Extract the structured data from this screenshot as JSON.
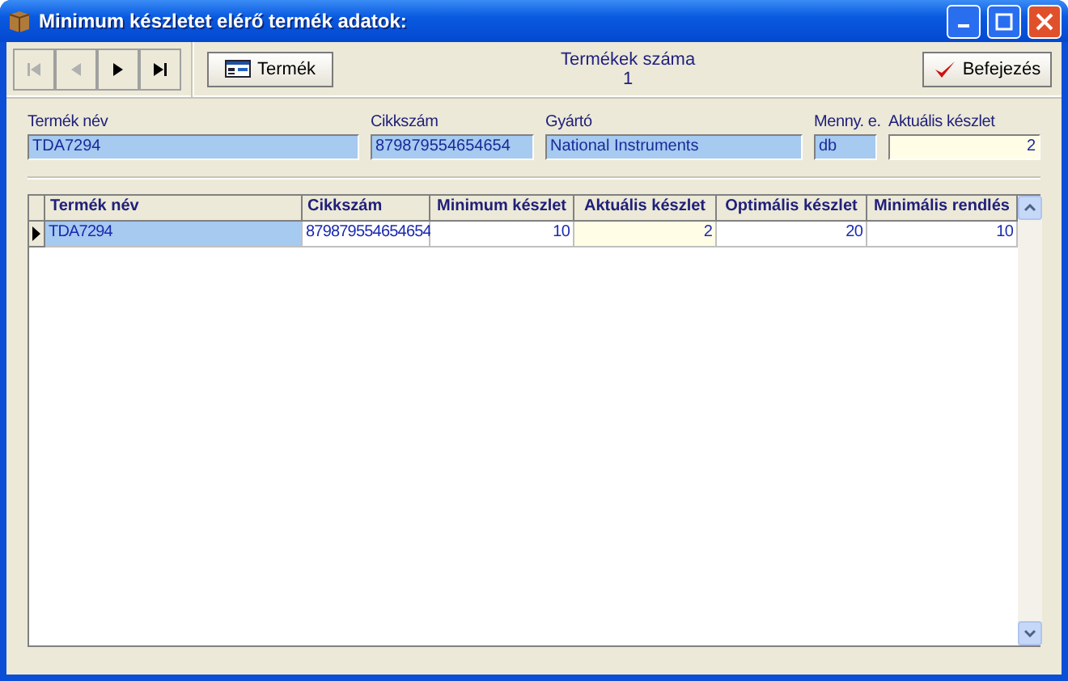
{
  "window": {
    "title": "Minimum készletet elérő termék adatok:"
  },
  "nav_buttons": [
    {
      "kind": "first",
      "disabled": true
    },
    {
      "kind": "prev",
      "disabled": true
    },
    {
      "kind": "next",
      "disabled": false
    },
    {
      "kind": "last",
      "disabled": false
    }
  ],
  "product_button": {
    "label": "Termék"
  },
  "count": {
    "label": "Termékek száma",
    "value": "1"
  },
  "finish_button": {
    "label": "Befejezés"
  },
  "fields": [
    {
      "label": "Termék név",
      "value": "TDA7294",
      "kind": "text"
    },
    {
      "label": "Cikkszám",
      "value": "879879554654654",
      "kind": "text"
    },
    {
      "label": "Gyártó",
      "value": "National Instruments",
      "kind": "text"
    },
    {
      "label": "Menny. e.",
      "value": "db",
      "kind": "text"
    },
    {
      "label": "Aktuális készlet",
      "value": "2",
      "kind": "number"
    }
  ],
  "table": {
    "columns": [
      "Termék név",
      "Cikkszám",
      "Minimum készlet",
      "Aktuális készlet",
      "Optimális készlet",
      "Minimális rendlés"
    ],
    "rows": [
      {
        "selected": true,
        "cells": [
          "TDA7294",
          "879879554654654",
          "10",
          "2",
          "20",
          "10"
        ]
      }
    ]
  }
}
